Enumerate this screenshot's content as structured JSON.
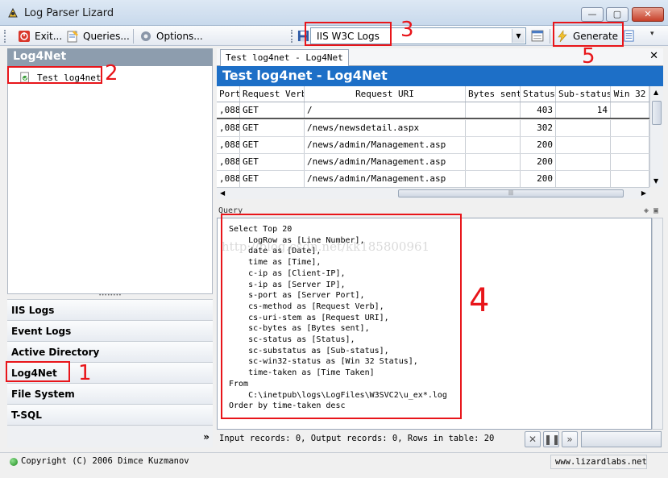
{
  "window": {
    "title": "Log Parser Lizard"
  },
  "toolbar": {
    "exit_label": "Exit...",
    "queries_label": "Queries...",
    "options_label": "Options...",
    "log_type_value": "IIS W3C Logs",
    "generate_label": "Generate"
  },
  "left_panel": {
    "header": "Log4Net",
    "tree_item": "Test log4net",
    "nav_items": [
      "IIS Logs",
      "Event Logs",
      "Active Directory",
      "Log4Net",
      "File System",
      "T-SQL"
    ]
  },
  "tab": {
    "label": "Test log4net - Log4Net"
  },
  "report": {
    "title": "Test log4net - Log4Net"
  },
  "grid": {
    "columns": [
      "Port",
      "Request Verb",
      "Request URI",
      "Bytes sent",
      "Status",
      "Sub-status",
      "Win 32"
    ],
    "rows": [
      [
        ",088",
        "GET",
        "/",
        "",
        "403",
        "14",
        ""
      ],
      [
        ",088",
        "GET",
        "/news/newsdetail.aspx",
        "",
        "302",
        "",
        ""
      ],
      [
        ",088",
        "GET",
        "/news/admin/Management.asp",
        "",
        "200",
        "",
        ""
      ],
      [
        ",088",
        "GET",
        "/news/admin/Management.asp",
        "",
        "200",
        "",
        ""
      ],
      [
        ",088",
        "GET",
        "/news/admin/Management.asp",
        "",
        "200",
        "",
        ""
      ]
    ]
  },
  "query": {
    "label": "Query",
    "text": "Select Top 20\n    LogRow as [Line Number],\n    date as [Date],\n    time as [Time],\n    c-ip as [Client-IP],\n    s-ip as [Server IP],\n    s-port as [Server Port],\n    cs-method as [Request Verb],\n    cs-uri-stem as [Request URI],\n    sc-bytes as [Bytes sent],\n    sc-status as [Status],\n    sc-substatus as [Sub-status],\n    sc-win32-status as [Win 32 Status],\n    time-taken as [Time Taken]\nFrom\n    C:\\inetpub\\logs\\LogFiles\\W3SVC2\\u_ex*.log\nOrder by time-taken desc",
    "watermark": "http://blog.csdn.net/kk185800961"
  },
  "status": {
    "text": "Input records: 0, Output records: 0, Rows in table: 20"
  },
  "footer": {
    "copyright": "Copyright (C) 2006 Dimce Kuzmanov",
    "site": "www.lizardlabs.net"
  },
  "annotations": [
    "1",
    "2",
    "3",
    "4",
    "5"
  ],
  "colors": {
    "accent": "#1d6fc7",
    "annotation": "#e8151a",
    "header_gray": "#8d9dae"
  }
}
